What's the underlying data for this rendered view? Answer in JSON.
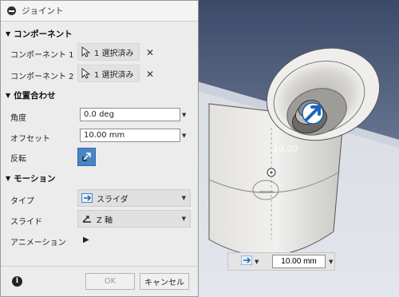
{
  "dialog": {
    "title": "ジョイント",
    "sections": {
      "component": "コンポーネント",
      "alignment": "位置合わせ",
      "motion": "モーション"
    },
    "component1": {
      "label": "コンポーネント 1",
      "value": "1 選択済み"
    },
    "component2": {
      "label": "コンポーネント 2",
      "value": "1 選択済み"
    },
    "angle": {
      "label": "角度",
      "value": "0.0 deg"
    },
    "offset": {
      "label": "オフセット",
      "value": "10.00 mm"
    },
    "flip": {
      "label": "反転"
    },
    "type": {
      "label": "タイプ",
      "value": "スライダ"
    },
    "slide": {
      "label": "スライド",
      "value": "Z 軸"
    },
    "animation": {
      "label": "アニメーション"
    },
    "ok_label": "OK",
    "cancel_label": "キャンセル",
    "info_label": "i",
    "clear_symbol": "✕",
    "play_symbol": "▶"
  },
  "viewport": {
    "offset_input": "10.00 mm",
    "dimension_label": "10.00"
  },
  "colors": {
    "accent": "#4a85c4",
    "dialog_bg": "#ececec",
    "model": "#e6e5e2"
  },
  "icons": {
    "title": "collapse-icon",
    "select": "cursor-arrow-icon",
    "clear": "close-icon",
    "flip": "flip-arrows-icon",
    "slider": "slider-joint-icon",
    "axis": "z-axis-icon",
    "play": "play-icon",
    "info": "info-icon"
  }
}
